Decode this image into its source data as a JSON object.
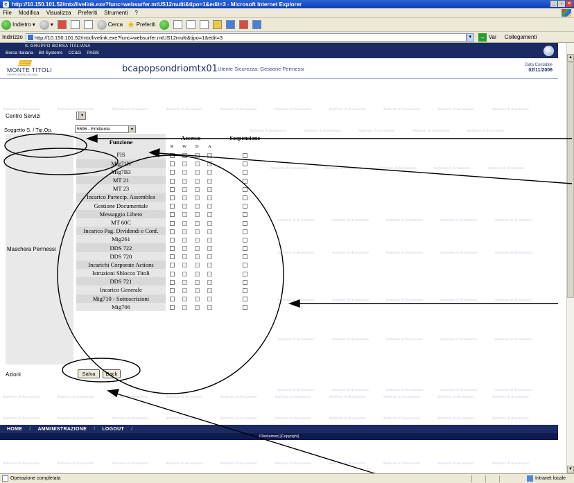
{
  "window": {
    "title": "http://10.150.101.52/mtx/livelink.exe?func=websurfer.mtUS12multi&tipo=1&edit=3 - Microsoft Internet Explorer",
    "buttons": [
      "_",
      "×"
    ]
  },
  "menu": [
    "File",
    "Modifica",
    "Visualizza",
    "Preferiti",
    "Strumenti",
    "?"
  ],
  "toolbar": {
    "back_label": "Indietro",
    "search_label": "Cerca",
    "favorites_label": "Preferiti"
  },
  "address": {
    "label": "Indirizzo",
    "url": "http://10.150.101.52/mtx/livelink.exe?func=websurfer.mtUS12multi&tipo=1&edit=3",
    "go_label": "Vai",
    "links_label": "Collegamenti"
  },
  "borsa": {
    "group_title": "IL GRUPPO BORSA ITALIANA",
    "nav": [
      "Borsa Italiana",
      "BIt Systems",
      "CC&G",
      "PAGS"
    ]
  },
  "header": {
    "logo_name": "MONTE TITOLI",
    "logo_tag": "GRUPPO BORSA ITALIANA",
    "user_code": "bcapopsondriomtx01",
    "section": "Utente Sicurezza: Gestione Permessi",
    "date_label": "Data Contabile",
    "date_value": "02/11/2006"
  },
  "watermark_text": "Ambiente di Avviamento",
  "form": {
    "centro_label": "Centro Servizi",
    "soggetto_label": "Soggetto S. / Tip.Op.",
    "soggetto_value": "5696 - Emittente",
    "maschera_label": "Maschera Permessi",
    "azioni_label": "Azioni",
    "save_button": "Salva",
    "back_button": "Back"
  },
  "permissions": {
    "col_function": "Funzione",
    "col_access": "Accesso",
    "col_suspension": "Sospensione",
    "access_flags": [
      "R",
      "W",
      "D",
      "A"
    ],
    "rows": [
      {
        "name": "FIS"
      },
      {
        "name": "Mig71N"
      },
      {
        "name": "Mig7B3"
      },
      {
        "name": "MT 21"
      },
      {
        "name": "MT 23"
      },
      {
        "name": "Incarico Partecip. Assemblea"
      },
      {
        "name": "Gestione Documentale"
      },
      {
        "name": "Messaggio Libero"
      },
      {
        "name": "MT 60C"
      },
      {
        "name": "Incarico Pag. Dividendi e Conf."
      },
      {
        "name": "Mig261"
      },
      {
        "name": "DDS 722"
      },
      {
        "name": "DDS 720"
      },
      {
        "name": "Incarichi Corporate Actions"
      },
      {
        "name": "Istruzioni Sblocco Titoli"
      },
      {
        "name": "DDS 721"
      },
      {
        "name": "Incarico Generale"
      },
      {
        "name": "Mig710 - Sottoscrizioni"
      },
      {
        "name": "Mig706"
      }
    ]
  },
  "footer": {
    "nav": [
      "HOME",
      "AMMINISTRAZIONE",
      "LOGOUT"
    ],
    "disclaimer": "[Disclaimer] [Copyright]"
  },
  "status": {
    "text": "Operazione completata",
    "zone": "Intranet locale"
  }
}
